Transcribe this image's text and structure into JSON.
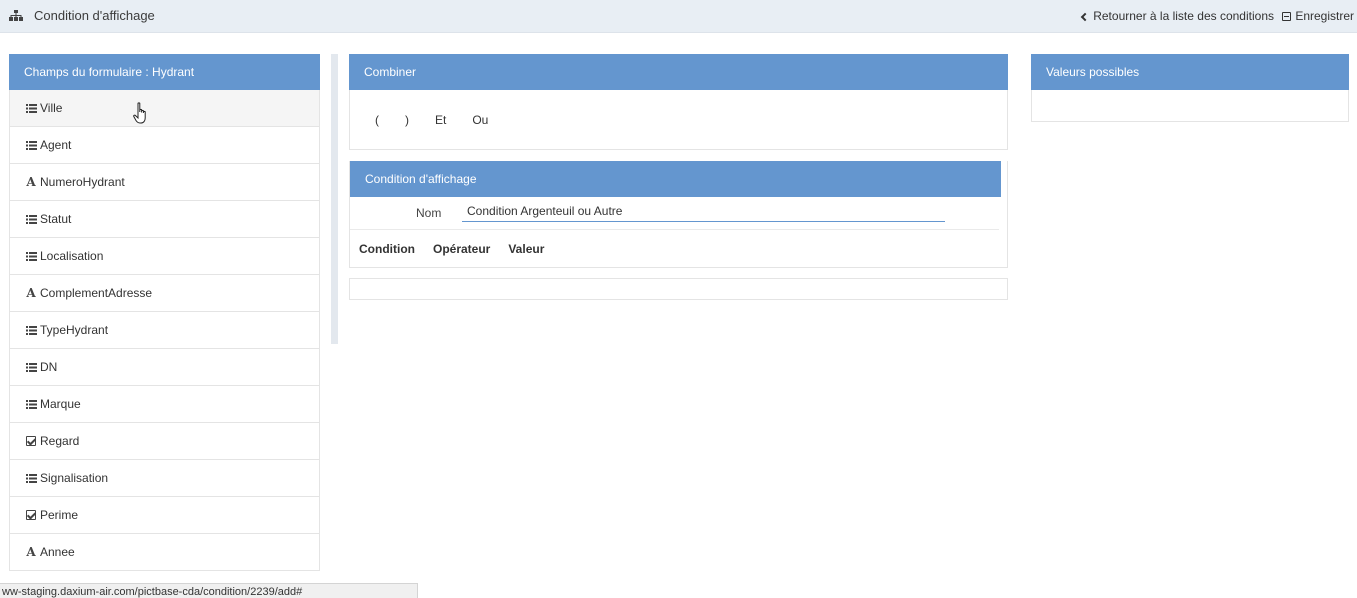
{
  "header": {
    "icon": "sitemap-icon",
    "title": "Condition d'affichage",
    "back_link": "Retourner à la liste des conditions",
    "save_button": "Enregistrer"
  },
  "fields_panel": {
    "title": "Champs du formulaire : Hydrant",
    "items": [
      {
        "label": "Ville",
        "icon": "list-icon"
      },
      {
        "label": "Agent",
        "icon": "list-icon"
      },
      {
        "label": "NumeroHydrant",
        "icon": "font-icon"
      },
      {
        "label": "Statut",
        "icon": "list-icon"
      },
      {
        "label": "Localisation",
        "icon": "list-icon"
      },
      {
        "label": "ComplementAdresse",
        "icon": "font-icon"
      },
      {
        "label": "TypeHydrant",
        "icon": "list-icon"
      },
      {
        "label": "DN",
        "icon": "list-icon"
      },
      {
        "label": "Marque",
        "icon": "list-icon"
      },
      {
        "label": "Regard",
        "icon": "check-square-icon"
      },
      {
        "label": "Signalisation",
        "icon": "list-icon"
      },
      {
        "label": "Perime",
        "icon": "check-square-icon"
      },
      {
        "label": "Annee",
        "icon": "font-icon"
      }
    ]
  },
  "combine_panel": {
    "title": "Combiner",
    "operators": [
      "(",
      ")",
      "Et",
      "Ou"
    ]
  },
  "condition_panel": {
    "title": "Condition d'affichage",
    "name_label": "Nom",
    "name_value": "Condition Argenteuil ou Autre",
    "columns": [
      "Condition",
      "Opérateur",
      "Valeur"
    ]
  },
  "values_panel": {
    "title": "Valeurs possibles"
  },
  "status_bar": {
    "url": "ww-staging.daxium-air.com/pictbase-cda/condition/2239/add#"
  }
}
